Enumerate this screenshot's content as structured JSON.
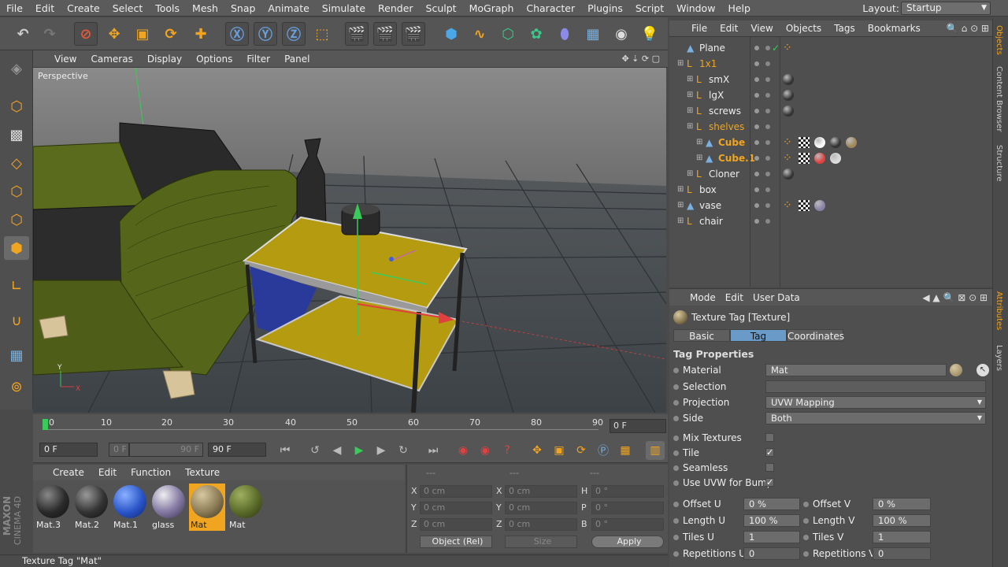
{
  "menubar": {
    "items": [
      "File",
      "Edit",
      "Create",
      "Select",
      "Tools",
      "Mesh",
      "Snap",
      "Animate",
      "Simulate",
      "Render",
      "Sculpt",
      "MoGraph",
      "Character",
      "Plugins",
      "Script",
      "Window",
      "Help"
    ],
    "layout_label": "Layout:",
    "layout_value": "Startup"
  },
  "viewport": {
    "menu": [
      "View",
      "Cameras",
      "Display",
      "Options",
      "Filter",
      "Panel"
    ],
    "label": "Perspective",
    "axis_y": "Y",
    "axis_x": "X"
  },
  "timeline": {
    "ticks": [
      "0",
      "10",
      "20",
      "30",
      "40",
      "50",
      "60",
      "70",
      "80",
      "90"
    ],
    "current_frame": "0 F"
  },
  "transport": {
    "start_field": "0 F",
    "range_start": "0 F",
    "range_end": "90 F",
    "end_field": "90 F"
  },
  "material_manager": {
    "menu": [
      "Create",
      "Edit",
      "Function",
      "Texture"
    ],
    "materials": [
      {
        "name": "Mat.3",
        "color": "#2a2a2a",
        "selected": false
      },
      {
        "name": "Mat.2",
        "color": "#333333",
        "selected": false
      },
      {
        "name": "Mat.1",
        "color": "#2a55c8",
        "selected": false
      },
      {
        "name": "glass",
        "color": "#8a80a8",
        "selected": false
      },
      {
        "name": "Mat",
        "color": "#8a7a55",
        "selected": true
      },
      {
        "name": "Mat",
        "color": "#5a6b2a",
        "selected": false
      }
    ]
  },
  "coordinates": {
    "header": [
      "---",
      "---",
      "---"
    ],
    "pos_labels": [
      "X",
      "Y",
      "Z"
    ],
    "pos_values": [
      "0 cm",
      "0 cm",
      "0 cm"
    ],
    "size_labels": [
      "X",
      "Y",
      "Z"
    ],
    "size_values": [
      "0 cm",
      "0 cm",
      "0 cm"
    ],
    "rot_labels": [
      "H",
      "P",
      "B"
    ],
    "rot_values": [
      "0 °",
      "0 °",
      "0 °"
    ],
    "mode": "Object (Rel)",
    "size_mode": "Size",
    "apply": "Apply"
  },
  "statusbar": {
    "text": "Texture Tag \"Mat\""
  },
  "maxon": {
    "line1": "MAXON",
    "line2": "CINEMA 4D"
  },
  "object_manager": {
    "menu": [
      "File",
      "Edit",
      "View",
      "Objects",
      "Tags",
      "Bookmarks"
    ],
    "rows": [
      {
        "name": "Plane",
        "level": 0,
        "style": "normal"
      },
      {
        "name": "1x1",
        "level": 0,
        "style": "orange"
      },
      {
        "name": "smX",
        "level": 1,
        "style": "normal"
      },
      {
        "name": "lgX",
        "level": 1,
        "style": "normal"
      },
      {
        "name": "screws",
        "level": 1,
        "style": "normal"
      },
      {
        "name": "shelves",
        "level": 1,
        "style": "orange"
      },
      {
        "name": "Cube",
        "level": 2,
        "style": "hl"
      },
      {
        "name": "Cube.1",
        "level": 2,
        "style": "hl"
      },
      {
        "name": "Cloner",
        "level": 1,
        "style": "normal"
      },
      {
        "name": "box",
        "level": 0,
        "style": "normal"
      },
      {
        "name": "vase",
        "level": 0,
        "style": "normal"
      },
      {
        "name": "chair",
        "level": 0,
        "style": "normal"
      }
    ]
  },
  "right_tabs": [
    "Objects",
    "Content Browser",
    "Structure",
    "Attributes",
    "Layers"
  ],
  "attribute_manager": {
    "menu": [
      "Mode",
      "Edit",
      "User Data"
    ],
    "title": "Texture Tag [Texture]",
    "tabs": [
      "Basic",
      "Tag",
      "Coordinates"
    ],
    "active_tab": "Tag",
    "section": "Tag Properties",
    "material_label": "Material",
    "material_value": "Mat",
    "selection_label": "Selection",
    "selection_value": "",
    "projection_label": "Projection",
    "projection_value": "UVW Mapping",
    "side_label": "Side",
    "side_value": "Both",
    "mix_label": "Mix Textures",
    "mix_checked": false,
    "tile_label": "Tile",
    "tile_checked": true,
    "seamless_label": "Seamless",
    "seamless_checked": false,
    "uvwbump_label": "Use UVW for Bump",
    "uvwbump_checked": true,
    "offset_u_label": "Offset U",
    "offset_u": "0 %",
    "offset_v_label": "Offset V",
    "offset_v": "0 %",
    "length_u_label": "Length U",
    "length_u": "100 %",
    "length_v_label": "Length V",
    "length_v": "100 %",
    "tiles_u_label": "Tiles U",
    "tiles_u": "1",
    "tiles_v_label": "Tiles V",
    "tiles_v": "1",
    "rep_u_label": "Repetitions U",
    "rep_u": "0",
    "rep_v_label": "Repetitions V",
    "rep_v": "0"
  },
  "colors": {
    "accent": "#f0a521",
    "tab_active": "#6a9bc8",
    "background": "#4a4a4a"
  }
}
